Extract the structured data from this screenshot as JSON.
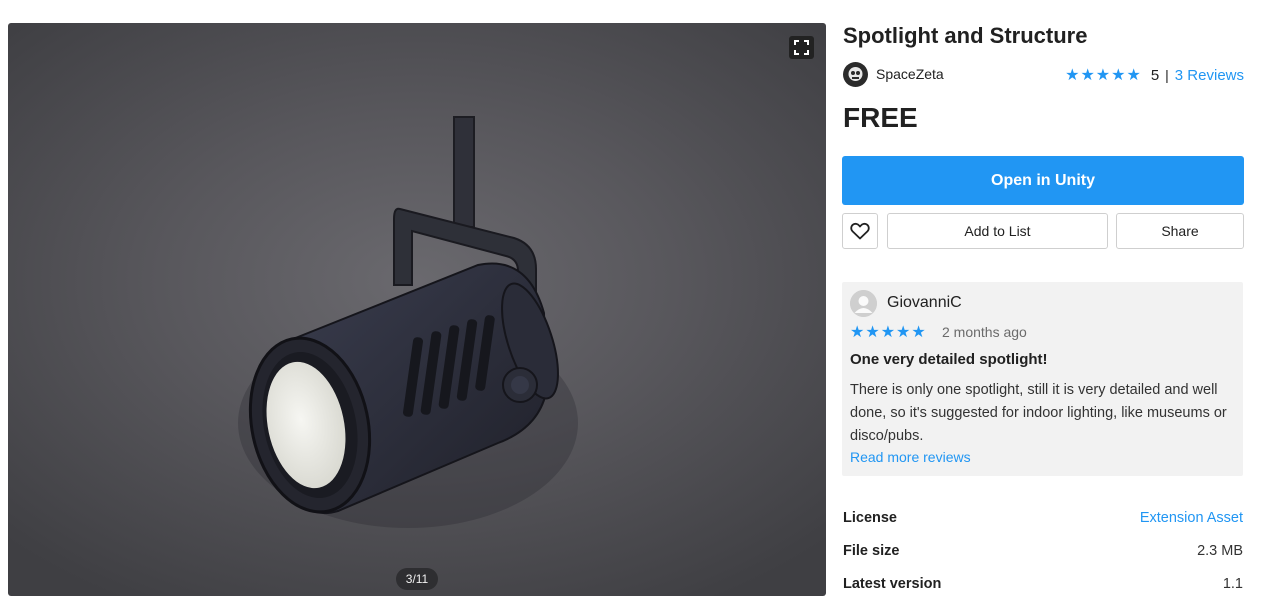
{
  "product": {
    "title": "Spotlight and Structure",
    "author": "SpaceZeta",
    "stars": "★★★★★",
    "rating_value": "5",
    "separator": "|",
    "reviews_link": "3 Reviews",
    "price": "FREE"
  },
  "gallery": {
    "counter": "3/11",
    "fullscreen_icon": "fullscreen-icon"
  },
  "actions": {
    "open_label": "Open in Unity",
    "add_to_list_label": "Add to List",
    "share_label": "Share",
    "heart_icon": "heart-icon"
  },
  "review": {
    "author": "GiovanniC",
    "stars": "★★★★★",
    "date": "2 months ago",
    "title": "One very detailed spotlight!",
    "body": "There is only one spotlight, still it is very detailed and well done, so it's suggested for indoor lighting, like museums or disco/pubs.",
    "read_more": "Read more reviews"
  },
  "specs": [
    {
      "label": "License",
      "value": "Extension Asset"
    },
    {
      "label": "File size",
      "value": "2.3 MB"
    },
    {
      "label": "Latest version",
      "value": "1.1"
    }
  ],
  "colors": {
    "accent": "#2196f3",
    "card_bg": "#f2f2f2"
  }
}
